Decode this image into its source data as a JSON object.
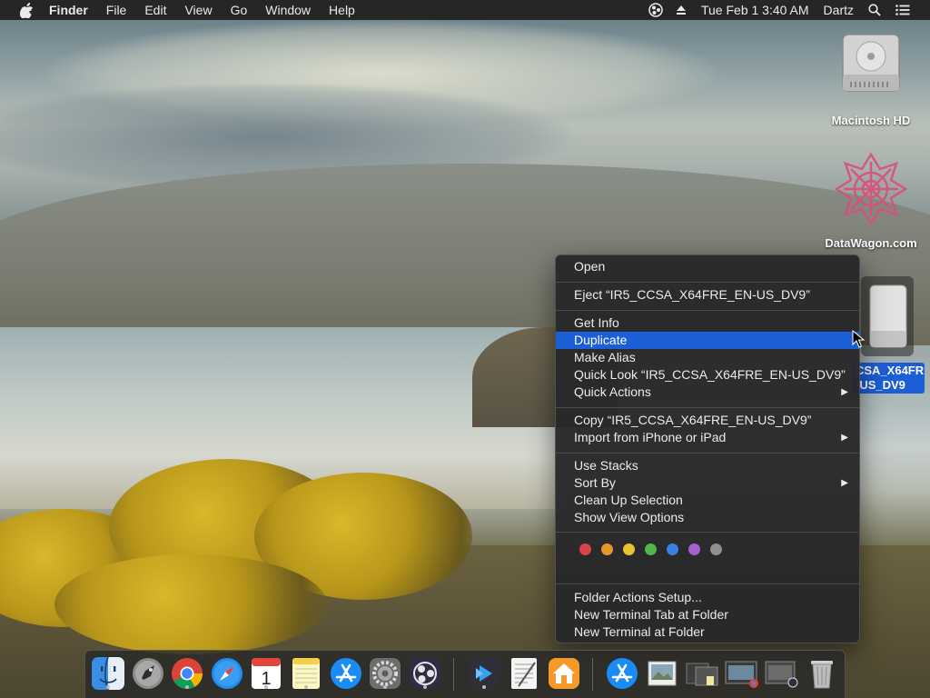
{
  "menubar": {
    "app_name": "Finder",
    "menus": [
      "File",
      "Edit",
      "View",
      "Go",
      "Window",
      "Help"
    ],
    "datetime": "Tue Feb 1  3:40 AM",
    "user": "Dartz"
  },
  "desktop": {
    "macintosh_hd": "Macintosh HD",
    "datawagon": "DataWagon.com",
    "dvd_label_line1": "CSA_X64FR",
    "dvd_label_line2": "-US_DV9"
  },
  "context_menu": {
    "open": "Open",
    "eject": "Eject “IR5_CCSA_X64FRE_EN-US_DV9”",
    "get_info": "Get Info",
    "duplicate": "Duplicate",
    "make_alias": "Make Alias",
    "quick_look": "Quick Look “IR5_CCSA_X64FRE_EN-US_DV9”",
    "quick_actions": "Quick Actions",
    "copy": "Copy “IR5_CCSA_X64FRE_EN-US_DV9”",
    "import_iphone": "Import from iPhone or iPad",
    "use_stacks": "Use Stacks",
    "sort_by": "Sort By",
    "clean_up": "Clean Up Selection",
    "show_view_options": "Show View Options",
    "folder_actions": "Folder Actions Setup...",
    "new_terminal_tab": "New Terminal Tab at Folder",
    "new_terminal": "New Terminal at Folder",
    "tag_colors": [
      "#d8444a",
      "#e5962c",
      "#e6c52e",
      "#4cb94a",
      "#3b82e0",
      "#a45fd0",
      "#8e8e93"
    ]
  },
  "colors": {
    "highlight": "#1c5ed6",
    "menubar": "#262626"
  }
}
